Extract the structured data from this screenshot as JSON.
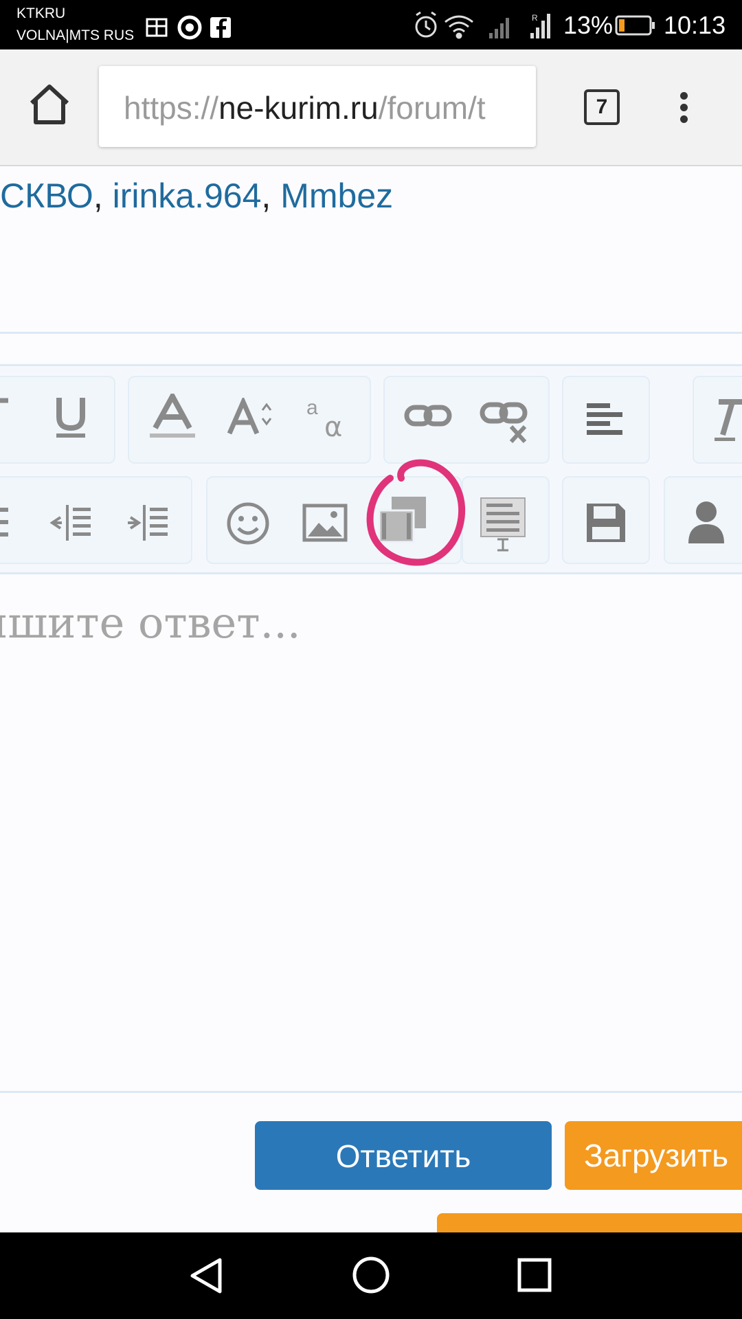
{
  "status_bar": {
    "carrier_line1": "KTKRU",
    "carrier_line2": "VOLNA|MTS RUS",
    "battery_percent": "13%",
    "time": "10:13",
    "icons": [
      "gift-icon",
      "chrome-icon",
      "facebook-icon",
      "alarm-icon",
      "wifi-icon",
      "signal-icon",
      "signal-roaming-icon",
      "battery-icon"
    ]
  },
  "browser": {
    "url_scheme": "https://",
    "url_domain": "ne-kurim.ru",
    "url_path": "/forum/t",
    "tab_count": "7"
  },
  "likers": {
    "names": [
      "СКВО",
      "irinka.964",
      "Mmbez"
    ],
    "separator": ", "
  },
  "toolbar": {
    "row1": [
      "italic-icon",
      "underline-icon",
      "font-color-icon",
      "font-size-icon",
      "font-family-icon",
      "link-icon",
      "unlink-icon",
      "align-icon",
      "remove-format-icon"
    ],
    "row2": [
      "list-icon",
      "outdent-icon",
      "indent-icon",
      "smiley-icon",
      "image-icon",
      "media-icon",
      "text-template-icon",
      "save-draft-icon",
      "user-icon"
    ]
  },
  "editor": {
    "placeholder": "ишите ответ..."
  },
  "actions": {
    "reply_label": "Ответить",
    "upload_label": "Загрузить"
  },
  "colors": {
    "link": "#1f6b9e",
    "reply_button": "#2b78b8",
    "upload_button": "#f49a1f",
    "highlight": "#e0337a"
  }
}
